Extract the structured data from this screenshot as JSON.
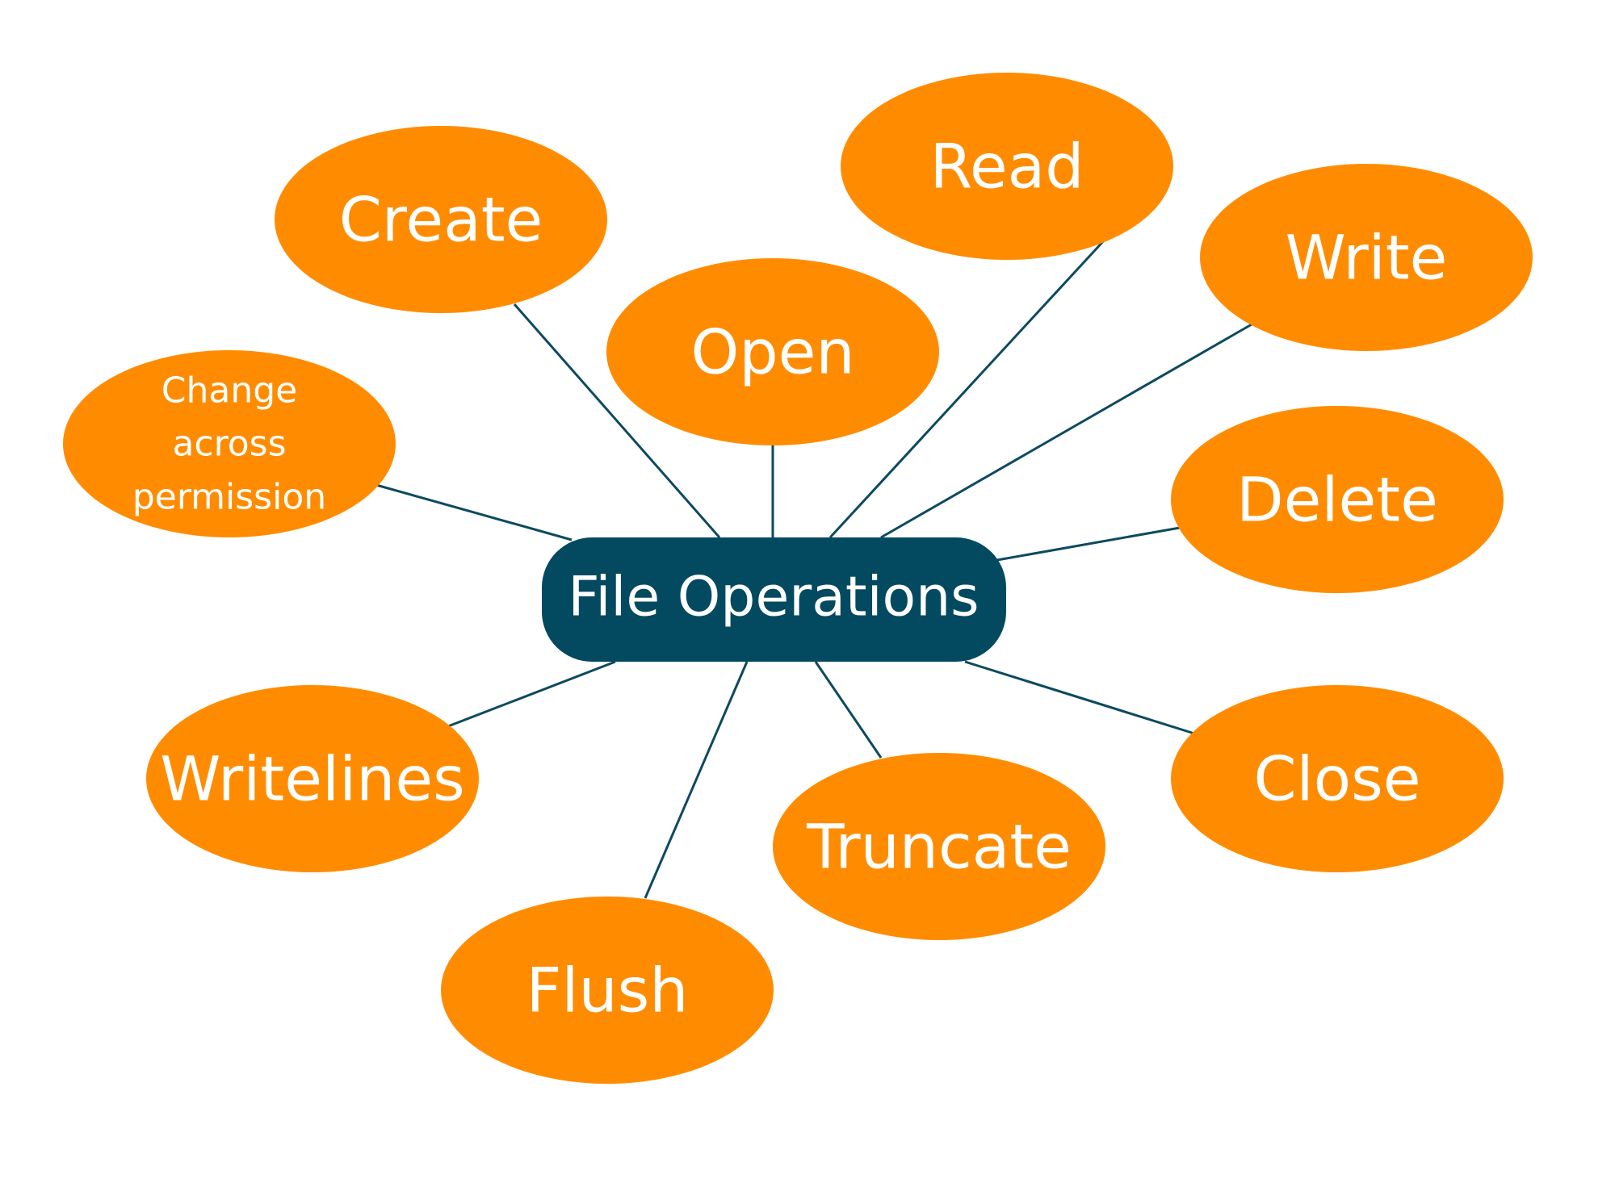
{
  "diagram": {
    "type": "mind-map",
    "center": {
      "label": "File Operations",
      "color": "#034a60"
    },
    "node_color": "#ff8c00",
    "connector_color": "#0d4a5f",
    "text_color": "#ffffff",
    "nodes": [
      {
        "id": "create",
        "lines": [
          "Create"
        ]
      },
      {
        "id": "read",
        "lines": [
          "Read"
        ]
      },
      {
        "id": "write",
        "lines": [
          "Write"
        ]
      },
      {
        "id": "open",
        "lines": [
          "Open"
        ]
      },
      {
        "id": "change-across-permission",
        "lines": [
          "Change",
          "across",
          "permission"
        ]
      },
      {
        "id": "delete",
        "lines": [
          "Delete"
        ]
      },
      {
        "id": "writelines",
        "lines": [
          "Writelines"
        ]
      },
      {
        "id": "truncate",
        "lines": [
          "Truncate"
        ]
      },
      {
        "id": "close",
        "lines": [
          "Close"
        ]
      },
      {
        "id": "flush",
        "lines": [
          "Flush"
        ]
      }
    ]
  }
}
